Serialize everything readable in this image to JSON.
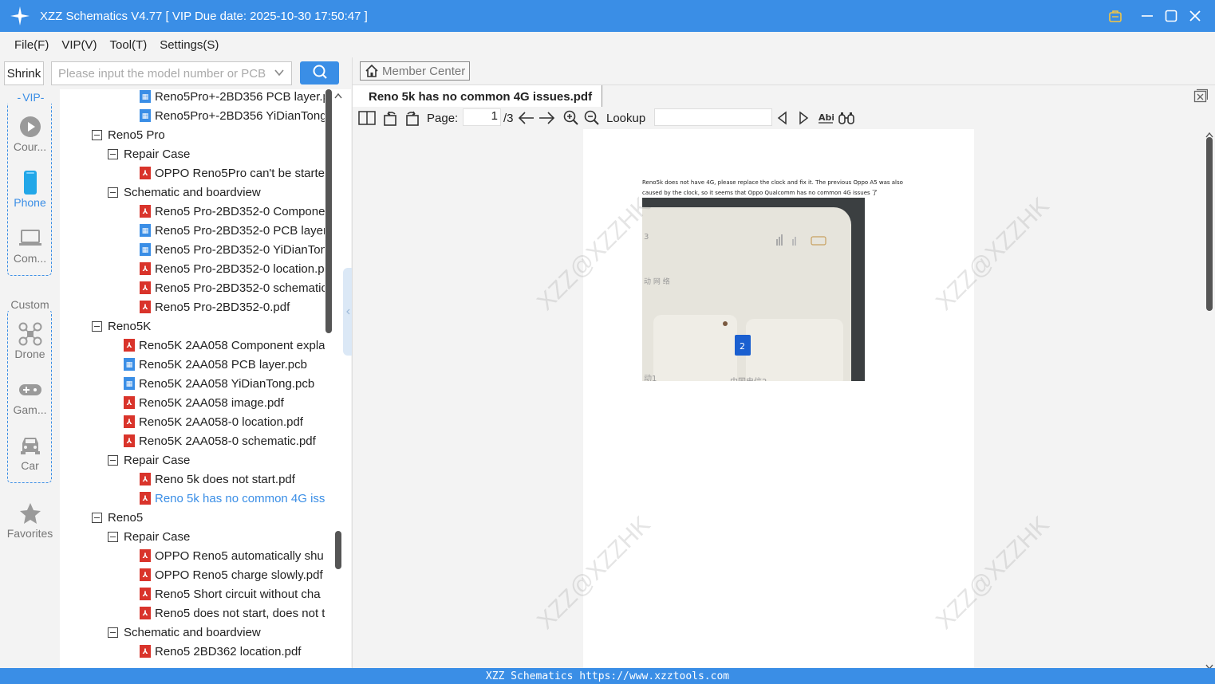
{
  "window": {
    "title": "XZZ Schematics V4.77 [ VIP Due date: 2025-10-30 17:50:47 ]"
  },
  "menu": [
    "File(F)",
    "VIP(V)",
    "Tool(T)",
    "Settings(S)"
  ],
  "search": {
    "shrink_label": "Shrink",
    "placeholder": "Please input the model number or PCB"
  },
  "categories": {
    "vip_label": "VIP",
    "custom_label": "Custom",
    "courses": "Cour...",
    "phone": "Phone",
    "computer": "Com...",
    "drone": "Drone",
    "game": "Gam...",
    "car": "Car",
    "favorites": "Favorites"
  },
  "tree": [
    {
      "text": "Reno5Pro+-2BD356 PCB layer.p",
      "icon": "pcb"
    },
    {
      "text": "Reno5Pro+-2BD356 YiDianTong",
      "icon": "pcb"
    },
    {
      "text": "Reno5 Pro",
      "icon": "folder"
    },
    {
      "text": "Repair Case",
      "icon": "folder"
    },
    {
      "text": "OPPO Reno5Pro can't be started",
      "icon": "pdf"
    },
    {
      "text": "Schematic and boardview",
      "icon": "folder"
    },
    {
      "text": "Reno5 Pro-2BD352-0 Compone",
      "icon": "pdf"
    },
    {
      "text": "Reno5 Pro-2BD352-0 PCB layer.",
      "icon": "pcb"
    },
    {
      "text": "Reno5 Pro-2BD352-0 YiDianTon",
      "icon": "pcb"
    },
    {
      "text": "Reno5 Pro-2BD352-0 location.p",
      "icon": "pdf"
    },
    {
      "text": "Reno5 Pro-2BD352-0 schematic",
      "icon": "pdf"
    },
    {
      "text": "Reno5 Pro-2BD352-0.pdf",
      "icon": "pdf"
    },
    {
      "text": "Reno5K",
      "icon": "folder"
    },
    {
      "text": "Reno5K 2AA058 Component expla",
      "icon": "pdf"
    },
    {
      "text": "Reno5K 2AA058 PCB layer.pcb",
      "icon": "pcb"
    },
    {
      "text": "Reno5K 2AA058 YiDianTong.pcb",
      "icon": "pcb"
    },
    {
      "text": "Reno5K 2AA058 image.pdf",
      "icon": "pdf"
    },
    {
      "text": "Reno5K 2AA058-0 location.pdf",
      "icon": "pdf"
    },
    {
      "text": "Reno5K 2AA058-0 schematic.pdf",
      "icon": "pdf"
    },
    {
      "text": "Repair Case",
      "icon": "folder"
    },
    {
      "text": "Reno 5k does not start.pdf",
      "icon": "pdf"
    },
    {
      "text": "Reno 5k has no common 4G iss",
      "icon": "pdf"
    },
    {
      "text": "Reno5",
      "icon": "folder"
    },
    {
      "text": "Repair Case",
      "icon": "folder"
    },
    {
      "text": "OPPO Reno5 automatically shu",
      "icon": "pdf"
    },
    {
      "text": "OPPO Reno5 charge slowly.pdf",
      "icon": "pdf"
    },
    {
      "text": "Reno5 Short circuit without cha",
      "icon": "pdf"
    },
    {
      "text": "Reno5 does not start, does not t",
      "icon": "pdf"
    },
    {
      "text": "Schematic and boardview",
      "icon": "folder"
    },
    {
      "text": "Reno5 2BD362 location.pdf",
      "icon": "pdf"
    }
  ],
  "viewer": {
    "member_center": "Member Center",
    "tab_title": "Reno 5k has no common 4G issues.pdf",
    "page_label": "Page:",
    "page_value": "1",
    "page_total": "/3",
    "lookup_label": "Lookup",
    "doc_text_line1": "Reno5k does not have 4G, please replace the clock and fix it. The previous Oppo A5 was also",
    "doc_text_line2": "caused by the clock, so it seems that Oppo Qualcomm has no common 4G issues 了",
    "watermark": "XZZ@XZZHK"
  },
  "status_bar": "XZZ Schematics https://www.xzztools.com",
  "colors": {
    "accent": "#3a8ee6",
    "pdf_icon": "#d9342b",
    "pcb_icon": "#3a8ee6"
  }
}
